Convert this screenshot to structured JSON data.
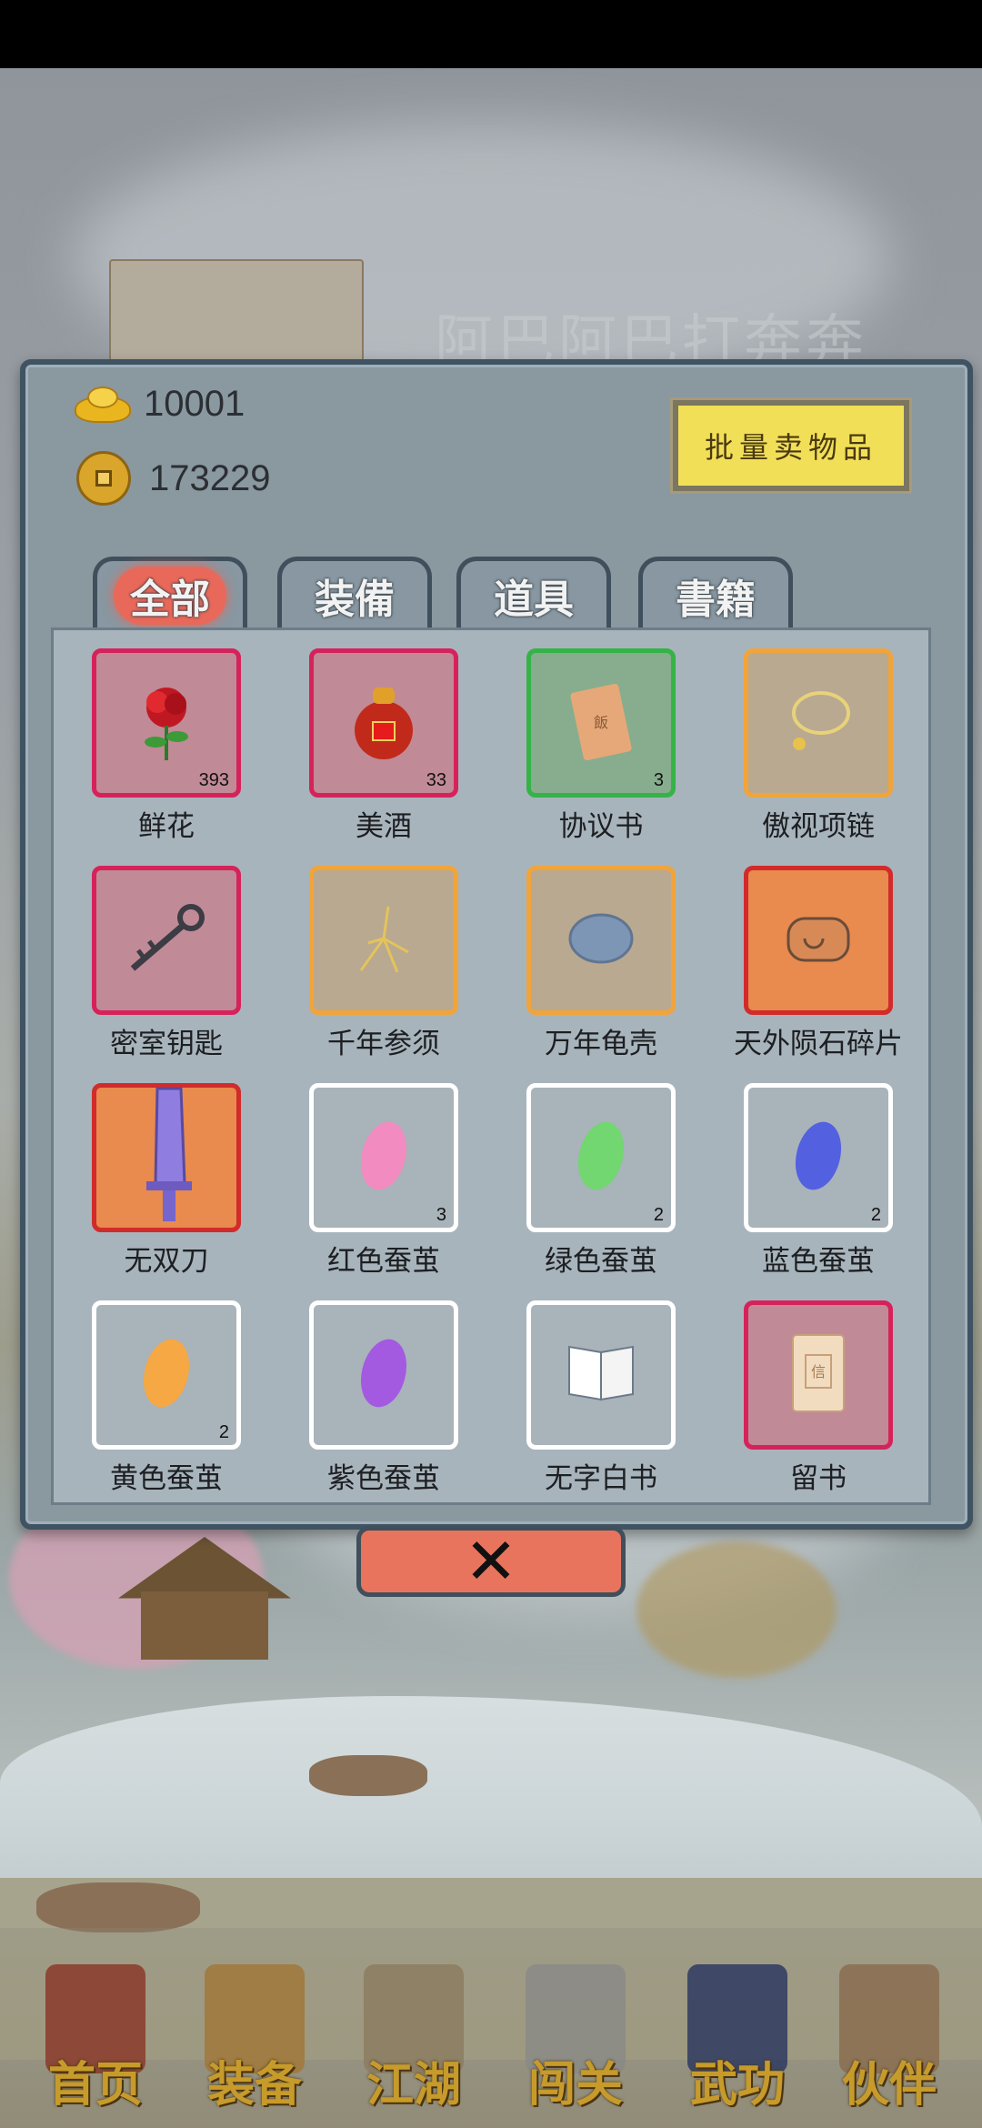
{
  "background": {
    "character_name": "阿巴阿巴打奔奔"
  },
  "currency": {
    "ingots": "10001",
    "coins": "173229"
  },
  "actions": {
    "bulk_sell_label": "批量卖物品",
    "close_symbol": "✕"
  },
  "tabs": [
    {
      "label": "全部",
      "active": true
    },
    {
      "label": "装備",
      "active": false
    },
    {
      "label": "道具",
      "active": false
    },
    {
      "label": "書籍",
      "active": false
    }
  ],
  "items": [
    {
      "name": "鲜花",
      "count": "393",
      "rarity": "red",
      "icon": "rose-icon"
    },
    {
      "name": "美酒",
      "count": "33",
      "rarity": "red",
      "icon": "wine-jar-icon"
    },
    {
      "name": "协议书",
      "count": "3",
      "rarity": "green",
      "icon": "document-icon"
    },
    {
      "name": "傲视项链",
      "count": "",
      "rarity": "orange",
      "icon": "necklace-icon"
    },
    {
      "name": "密室钥匙",
      "count": "",
      "rarity": "red",
      "icon": "key-icon"
    },
    {
      "name": "千年参须",
      "count": "",
      "rarity": "orange",
      "icon": "ginseng-icon"
    },
    {
      "name": "万年龟壳",
      "count": "",
      "rarity": "orange",
      "icon": "turtle-shell-icon"
    },
    {
      "name": "天外陨石碎片",
      "count": "",
      "rarity": "red-fill",
      "icon": "meteorite-icon"
    },
    {
      "name": "无双刀",
      "count": "",
      "rarity": "red-fill",
      "icon": "blade-icon"
    },
    {
      "name": "红色蚕茧",
      "count": "3",
      "rarity": "white",
      "icon": "pink-cocoon-icon",
      "color": "#f28bbf"
    },
    {
      "name": "绿色蚕茧",
      "count": "2",
      "rarity": "white",
      "icon": "green-cocoon-icon",
      "color": "#72d671"
    },
    {
      "name": "蓝色蚕茧",
      "count": "2",
      "rarity": "white",
      "icon": "blue-cocoon-icon",
      "color": "#5360e0"
    },
    {
      "name": "黄色蚕茧",
      "count": "2",
      "rarity": "white",
      "icon": "yellow-cocoon-icon",
      "color": "#f5a843"
    },
    {
      "name": "紫色蚕茧",
      "count": "",
      "rarity": "white",
      "icon": "purple-cocoon-icon",
      "color": "#a35ae0"
    },
    {
      "name": "无字白书",
      "count": "",
      "rarity": "white",
      "icon": "blank-book-icon"
    },
    {
      "name": "留书",
      "count": "",
      "rarity": "red",
      "icon": "letter-icon"
    }
  ],
  "nav": [
    {
      "label": "首页",
      "icon": "pavilion-icon",
      "active": true
    },
    {
      "label": "装备",
      "icon": "armor-icon"
    },
    {
      "label": "江湖",
      "icon": "scroll-icon"
    },
    {
      "label": "闯关",
      "icon": "crossed-swords-icon"
    },
    {
      "label": "武功",
      "icon": "manual-book-icon"
    },
    {
      "label": "伙伴",
      "icon": "companions-icon"
    }
  ]
}
